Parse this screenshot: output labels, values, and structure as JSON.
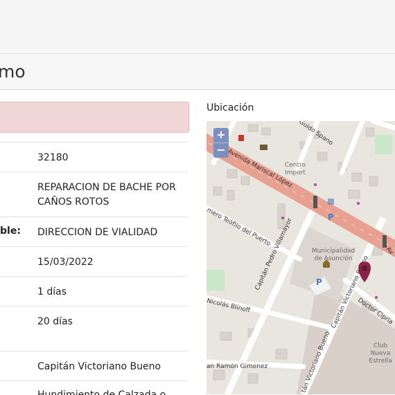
{
  "header": {
    "title": "mo"
  },
  "details": {
    "rows": [
      {
        "label": "",
        "value": "32180"
      },
      {
        "label": "",
        "value": "REPARACION DE BACHE POR CAÑOS ROTOS"
      },
      {
        "label": "ble:",
        "value": "DIRECCION DE VIALIDAD"
      },
      {
        "label": "",
        "value": "15/03/2022"
      },
      {
        "label": "",
        "value": "1 días"
      },
      {
        "label": "",
        "value": "20 días"
      },
      {
        "label": "",
        "value": "Capitán Victoriano Bueno"
      },
      {
        "label": "",
        "value": "Hundimiento de Calzada o"
      }
    ]
  },
  "map": {
    "label": "Ubicación",
    "zoom_in": "+",
    "zoom_out": "−",
    "streets": {
      "mariscal": "Avenida Mariscal López",
      "teofilo": "mero Teófilo del Puerto",
      "villamayor": "Capitán Pedro Villamayor",
      "blinoff": "Nicolás Blinoff",
      "victoriano_top": "Capitán Victoriano Bueno",
      "victoriano_bottom": "pitán Victoriano Bueno",
      "victoriano_low": "tán Victoriano Bueno",
      "cipriano": "Doctor Cipria",
      "gimenez": "an Ramón Gimenez",
      "guido": "Guido Spano",
      "av_right": "Av"
    },
    "places": {
      "centro_line1": "Centro",
      "centro_line2": "Import",
      "muni_line1": "Municipalidad",
      "muni_line2": "de Asunción",
      "club_line1": "Club",
      "club_line2": "Nueva",
      "club_line3": "Estrella"
    },
    "parking": "P",
    "colors": {
      "main_road": "#e8a090",
      "marker": "#8b2346"
    }
  }
}
